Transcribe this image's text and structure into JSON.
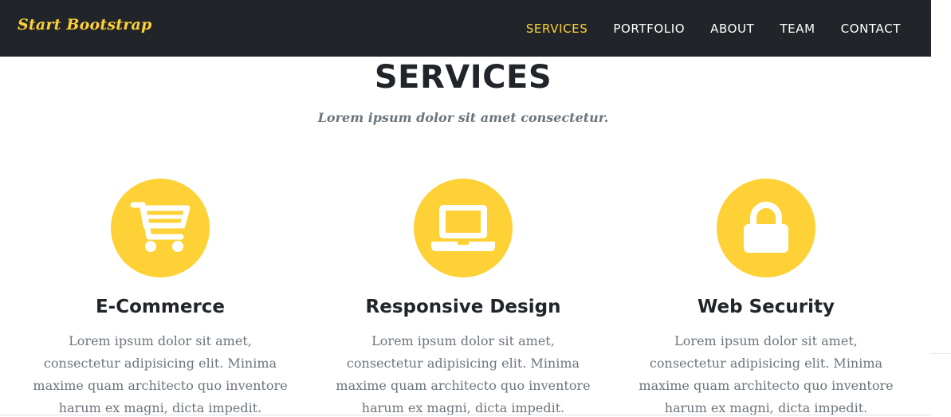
{
  "navbar": {
    "brand": "Start Bootstrap",
    "links": [
      "SERVICES",
      "PORTFOLIO",
      "ABOUT",
      "TEAM",
      "CONTACT"
    ],
    "active_index": 0
  },
  "section": {
    "heading": "SERVICES",
    "subheading": "Lorem ipsum dolor sit amet consectetur."
  },
  "services": [
    {
      "icon": "shopping-cart-icon",
      "title": "E-Commerce",
      "text": "Lorem ipsum dolor sit amet, consectetur adipisicing elit. Minima maxime quam architecto quo inventore harum ex magni, dicta impedit."
    },
    {
      "icon": "laptop-icon",
      "title": "Responsive Design",
      "text": "Lorem ipsum dolor sit amet, consectetur adipisicing elit. Minima maxime quam architecto quo inventore harum ex magni, dicta impedit."
    },
    {
      "icon": "lock-icon",
      "title": "Web Security",
      "text": "Lorem ipsum dolor sit amet, consectetur adipisicing elit. Minima maxime quam architecto quo inventore harum ex magni, dicta impedit."
    }
  ],
  "colors": {
    "navbar_bg": "#212529",
    "accent": "#fed136",
    "heading": "#212529",
    "muted": "#6c757d"
  }
}
